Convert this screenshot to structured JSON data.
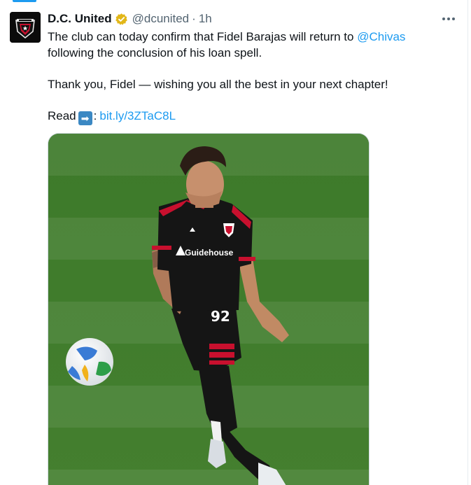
{
  "tweet": {
    "display_name": "D.C. United",
    "handle": "@dcunited",
    "separator": "·",
    "time": "1h",
    "more_label": "•••",
    "line1_pre": "The club can today confirm that Fidel Barajas will return to ",
    "line1_mention": "@Chivas",
    "line2": "following the conclusion of his loan spell.",
    "line3": "Thank you, Fidel — wishing you all the best in your next chapter!",
    "read_label": "Read",
    "arrow_emoji": "➡",
    "colon": ":",
    "link_text": "bit.ly/3ZTaC8L"
  },
  "media": {
    "jersey_number": "92",
    "sponsor": "Guidehouse",
    "description_icon": "soccer-ball-icon"
  },
  "colors": {
    "accent": "#1d9bf0",
    "text": "#0f1419",
    "muted": "#536471",
    "verified": "#e2b719",
    "pitch": "#3f7a2c",
    "kit": "#151515",
    "kit_stripe": "#c8102e"
  }
}
